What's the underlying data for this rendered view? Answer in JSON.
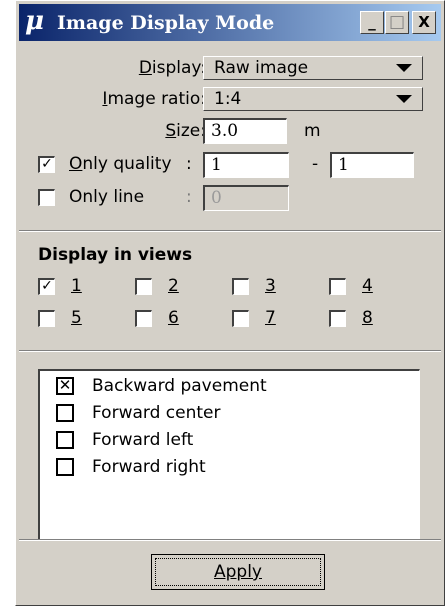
{
  "window": {
    "app_icon": "μ",
    "title": "Image Display Mode",
    "minimize": "_",
    "maximize": "□",
    "close": "X"
  },
  "display": {
    "label": "Display:",
    "label_u": "D",
    "label_rest": "isplay:",
    "value": "Raw image"
  },
  "image_ratio": {
    "label_u": "I",
    "label_rest": "mage ratio:",
    "value": "1:4"
  },
  "size": {
    "label_u": "S",
    "label_rest": "ize:",
    "value": "3.0",
    "unit": "m"
  },
  "only_quality": {
    "checked": true,
    "check_mark": "✓",
    "label_u": "O",
    "label_rest": "nly quality",
    "colon": ":",
    "from": "1",
    "dash": "-",
    "to": "1"
  },
  "only_line": {
    "checked": false,
    "label": "Only line",
    "colon": ":",
    "value": "0"
  },
  "views": {
    "heading": "Display in views",
    "items": [
      {
        "label": "1",
        "checked": true,
        "mark": "✓"
      },
      {
        "label": "2",
        "checked": false,
        "mark": ""
      },
      {
        "label": "3",
        "checked": false,
        "mark": ""
      },
      {
        "label": "4",
        "checked": false,
        "mark": ""
      },
      {
        "label": "5",
        "checked": false,
        "mark": ""
      },
      {
        "label": "6",
        "checked": false,
        "mark": ""
      },
      {
        "label": "7",
        "checked": false,
        "mark": ""
      },
      {
        "label": "8",
        "checked": false,
        "mark": ""
      }
    ]
  },
  "image_list": {
    "items": [
      {
        "label": "Backward pavement",
        "checked": true,
        "mark": "✕"
      },
      {
        "label": "Forward center",
        "checked": false,
        "mark": ""
      },
      {
        "label": "Forward left",
        "checked": false,
        "mark": ""
      },
      {
        "label": "Forward right",
        "checked": false,
        "mark": ""
      }
    ]
  },
  "apply_button": {
    "label": "Apply"
  }
}
